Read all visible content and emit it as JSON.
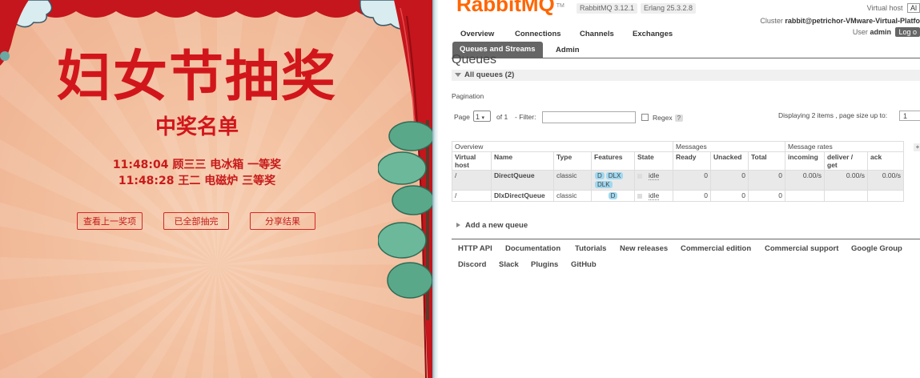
{
  "lottery": {
    "title": "妇女节抽奖",
    "subtitle": "中奖名单",
    "winners": [
      "11:48:04 顾三三 电冰箱 一等奖",
      "11:48:28 王二 电磁炉 三等奖"
    ],
    "buttons": [
      "查看上一奖项",
      "已全部抽完",
      "分享结果"
    ],
    "colors": {
      "title": "#d1161b",
      "background": "#f2bd9c",
      "curtain": "#c4161c",
      "pine": "#5aa88a"
    }
  },
  "rmq": {
    "logo": "RabbitMQ",
    "logo_tm": "TM",
    "version": "RabbitMQ 3.12.1",
    "erlang": "Erlang 25.3.2.8",
    "vhost_label": "Virtual host",
    "vhost_value": "Al",
    "cluster_label": "Cluster",
    "cluster_value": "rabbit@petrichor-VMware-Virtual-Platfo",
    "user_label": "User",
    "user_value": "admin",
    "logout": "Log o",
    "nav": [
      "Overview",
      "Connections",
      "Channels",
      "Exchanges",
      "Queues and Streams",
      "Admin"
    ],
    "page_title": "Queues",
    "all_queues": "All queues (2)",
    "pagination": {
      "label": "Pagination",
      "page": "Page",
      "page_value": "1",
      "of": "of 1",
      "filter": "- Filter:",
      "regex": "Regex",
      "help": "?",
      "displaying": "Displaying 2 items , page size up to:",
      "page_size": "1"
    },
    "table": {
      "groups": [
        "Overview",
        "Messages",
        "Message rates"
      ],
      "plus": "+",
      "headers": [
        "Virtual host",
        "Name",
        "Type",
        "Features",
        "State",
        "Ready",
        "Unacked",
        "Total",
        "incoming",
        "deliver / get",
        "ack"
      ],
      "rows": [
        {
          "vhost": "/",
          "name": "DirectQueue",
          "type": "classic",
          "features": [
            "D",
            "DLX",
            "DLK"
          ],
          "state": "idle",
          "ready": "0",
          "unacked": "0",
          "total": "0",
          "incoming": "0.00/s",
          "deliver": "0.00/s",
          "ack": "0.00/s"
        },
        {
          "vhost": "/",
          "name": "DlxDirectQueue",
          "type": "classic",
          "features": [
            "D"
          ],
          "state": "idle",
          "ready": "0",
          "unacked": "0",
          "total": "0",
          "incoming": "",
          "deliver": "",
          "ack": ""
        }
      ]
    },
    "add_queue": "Add a new queue",
    "footer": [
      "HTTP API",
      "Documentation",
      "Tutorials",
      "New releases",
      "Commercial edition",
      "Commercial support",
      "Google Group",
      "Discord",
      "Slack",
      "Plugins",
      "GitHub"
    ],
    "colors": {
      "logo": "#ff6600",
      "nav_active": "#666666",
      "feature_tag": "#a0d8f0"
    }
  }
}
